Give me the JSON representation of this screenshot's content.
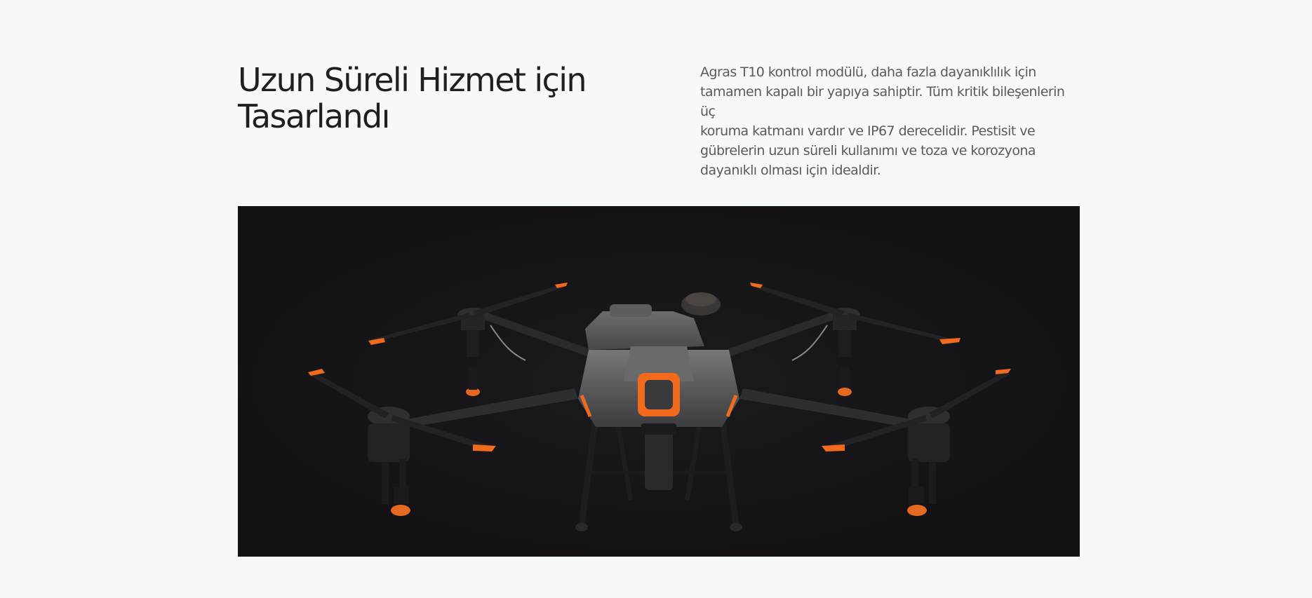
{
  "feature": {
    "heading_line1": "Uzun Süreli Hizmet için",
    "heading_line2": "Tasarlandı",
    "description_line1": "Agras T10 kontrol modülü, daha fazla dayanıklılık için",
    "description_line2": "tamamen kapalı bir yapıya sahiptir. Tüm kritik bileşenlerin üç",
    "description_line3": "koruma katmanı vardır ve IP67 derecelidir. Pestisit ve",
    "description_line4": "gübrelerin uzun süreli kullanımı ve toza ve korozyona",
    "description_line5": "dayanıklı olması için idealdir."
  },
  "image": {
    "subject": "agricultural-spray-drone",
    "colors": {
      "background": "#131215",
      "body": "#5b5b5e",
      "arm": "#2b2b2e",
      "accent": "#f26b1d"
    }
  }
}
